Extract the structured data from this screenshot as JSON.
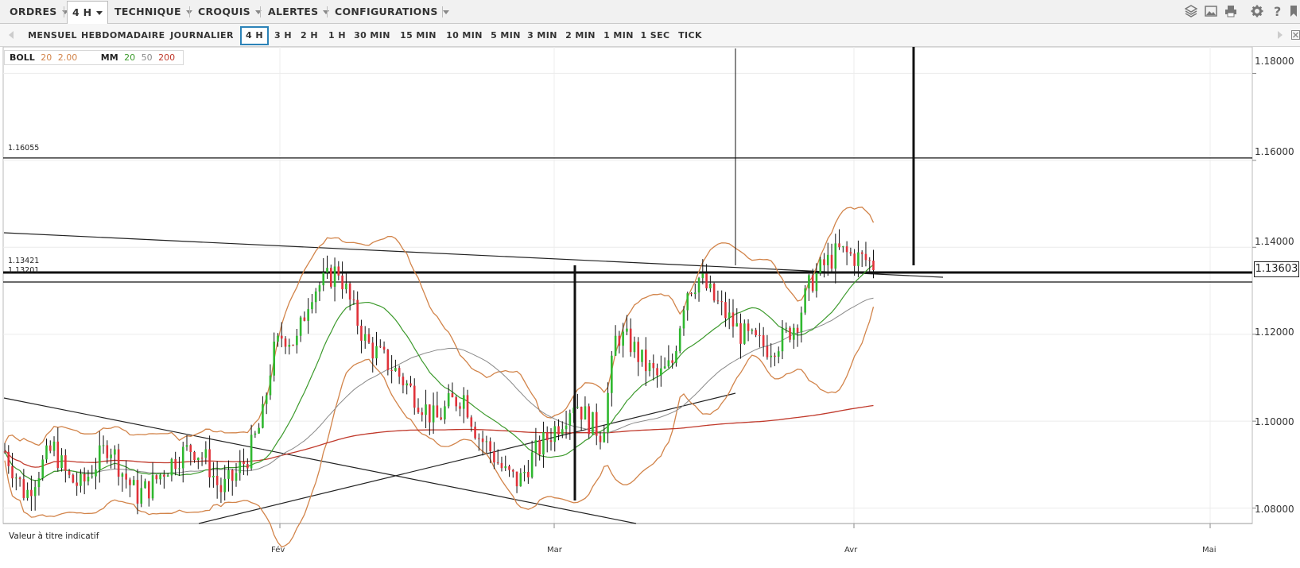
{
  "menu": {
    "items": [
      {
        "label": "ORDRES"
      },
      {
        "label": "4 H"
      },
      {
        "label": "TECHNIQUE"
      },
      {
        "label": "CROQUIS"
      },
      {
        "label": "ALERTES"
      },
      {
        "label": "CONFIGURATIONS"
      }
    ]
  },
  "toolbar_icons": [
    "layers-icon",
    "image-icon",
    "print-icon",
    "gear-icon",
    "help-icon",
    "bookmark-icon"
  ],
  "timeframes": {
    "items": [
      "MENSUEL",
      "HEBDOMADAIRE",
      "JOURNALIER",
      "4 H",
      "3 H",
      "2 H",
      "1 H",
      "30 MIN",
      "15 MIN",
      "10 MIN",
      "5 MIN",
      "3 MIN",
      "2 MIN",
      "1 MIN",
      "1 SEC",
      "TICK"
    ],
    "selected": "4 H"
  },
  "legend": {
    "boll_label": "BOLL",
    "boll_period": "20",
    "boll_dev": "2.00",
    "mm_label": "MM",
    "mm1": "20",
    "mm2": "50",
    "mm3": "200",
    "colors": {
      "boll": "#d2844a",
      "mm20": "#3c9a2c",
      "mm50": "#8a8a8a",
      "mm200": "#c0392b"
    }
  },
  "price_axis": {
    "ticks": [
      "1.18000",
      "1.16000",
      "1.14000",
      "1.12000",
      "1.10000",
      "1.08000"
    ],
    "current": "1.13603"
  },
  "levels": [
    "1.16055",
    "1.13421",
    "1.13201"
  ],
  "dates": [
    "Fév",
    "Mar",
    "Avr",
    "Mai"
  ],
  "footnote": "Valeur à titre indicatif",
  "chart_data": {
    "type": "candlestick",
    "symbol_timeframe": "4 H",
    "ylim": [
      1.077,
      1.183
    ],
    "x_axis_months": [
      "Fév",
      "Mar",
      "Avr",
      "Mai"
    ],
    "horizontal_levels": [
      1.16055,
      1.13421,
      1.13201
    ],
    "current_price": 1.13603,
    "indicators": [
      "BOLL 20 2.00",
      "MM 20",
      "MM 50",
      "MM 200"
    ],
    "close_path": [
      [
        0,
        1.093
      ],
      [
        0.015,
        1.088
      ],
      [
        0.03,
        1.083
      ],
      [
        0.05,
        1.089
      ],
      [
        0.07,
        1.094
      ],
      [
        0.09,
        1.087
      ],
      [
        0.11,
        1.085
      ],
      [
        0.13,
        1.09
      ],
      [
        0.15,
        1.095
      ],
      [
        0.17,
        1.088
      ],
      [
        0.19,
        1.083
      ],
      [
        0.21,
        1.085
      ],
      [
        0.23,
        1.089
      ],
      [
        0.25,
        1.092
      ],
      [
        0.27,
        1.094
      ],
      [
        0.29,
        1.091
      ],
      [
        0.31,
        1.084
      ],
      [
        0.33,
        1.087
      ],
      [
        0.35,
        1.092
      ],
      [
        0.37,
        1.1
      ],
      [
        0.385,
        1.115
      ],
      [
        0.4,
        1.12
      ],
      [
        0.42,
        1.118
      ],
      [
        0.44,
        1.13
      ],
      [
        0.46,
        1.132
      ],
      [
        0.48,
        1.135
      ],
      [
        0.5,
        1.126
      ],
      [
        0.52,
        1.118
      ],
      [
        0.54,
        1.115
      ],
      [
        0.56,
        1.112
      ],
      [
        0.58,
        1.108
      ],
      [
        0.6,
        1.104
      ],
      [
        0.62,
        1.1
      ],
      [
        0.64,
        1.104
      ],
      [
        0.66,
        1.106
      ],
      [
        0.68,
        1.097
      ],
      [
        0.7,
        1.093
      ],
      [
        0.72,
        1.088
      ],
      [
        0.74,
        1.086
      ],
      [
        0.76,
        1.092
      ],
      [
        0.78,
        1.096
      ],
      [
        0.8,
        1.1
      ],
      [
        0.82,
        1.105
      ],
      [
        0.84,
        1.1
      ],
      [
        0.86,
        1.097
      ],
      [
        0.88,
        1.12
      ],
      [
        0.9,
        1.118
      ],
      [
        0.92,
        1.113
      ],
      [
        0.94,
        1.11
      ],
      [
        0.96,
        1.113
      ],
      [
        0.98,
        1.13
      ],
      [
        1.0,
        1.133
      ],
      [
        1.02,
        1.128
      ],
      [
        1.04,
        1.124
      ],
      [
        1.06,
        1.12
      ],
      [
        1.08,
        1.118
      ],
      [
        1.1,
        1.117
      ],
      [
        1.12,
        1.119
      ],
      [
        1.14,
        1.123
      ],
      [
        1.16,
        1.132
      ],
      [
        1.18,
        1.136
      ],
      [
        1.2,
        1.139
      ],
      [
        1.22,
        1.138
      ],
      [
        1.24,
        1.137
      ],
      [
        1.25,
        1.136
      ]
    ]
  }
}
